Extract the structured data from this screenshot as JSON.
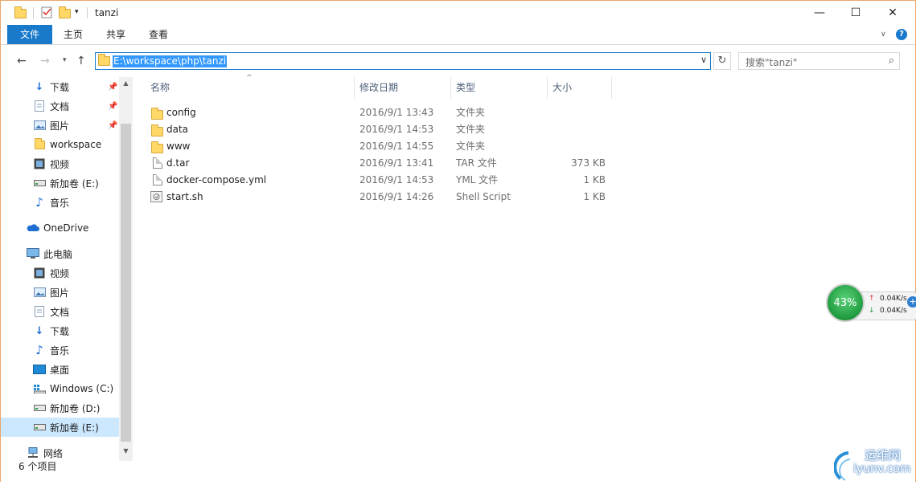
{
  "window": {
    "title": "tanzi",
    "controls": {
      "minimize": "—",
      "maximize": "☐",
      "close": "✕"
    }
  },
  "ribbon": {
    "tabs": [
      "文件",
      "主页",
      "共享",
      "查看"
    ],
    "help_icon": "?"
  },
  "address": {
    "path": "E:\\workspace\\php\\tanzi"
  },
  "search": {
    "placeholder": "搜索\"tanzi\""
  },
  "sidebar": {
    "items": [
      {
        "label": "下载",
        "icon": "download-icon",
        "pinned": true
      },
      {
        "label": "文档",
        "icon": "document-icon",
        "pinned": true
      },
      {
        "label": "图片",
        "icon": "picture-icon",
        "pinned": true
      },
      {
        "label": "workspace",
        "icon": "folder-icon",
        "pinned": false
      },
      {
        "label": "视频",
        "icon": "video-icon",
        "pinned": false
      },
      {
        "label": "新加卷 (E:)",
        "icon": "drive-icon",
        "pinned": false
      },
      {
        "label": "音乐",
        "icon": "music-icon",
        "pinned": false
      },
      {
        "label": "OneDrive",
        "icon": "cloud-icon",
        "pinned": false
      },
      {
        "label": "此电脑",
        "icon": "computer-icon",
        "pinned": false
      },
      {
        "label": "视频",
        "icon": "video-icon",
        "pinned": false
      },
      {
        "label": "图片",
        "icon": "picture-icon",
        "pinned": false
      },
      {
        "label": "文档",
        "icon": "document-icon",
        "pinned": false
      },
      {
        "label": "下载",
        "icon": "download-icon",
        "pinned": false
      },
      {
        "label": "音乐",
        "icon": "music-icon",
        "pinned": false
      },
      {
        "label": "桌面",
        "icon": "desktop-icon",
        "pinned": false
      },
      {
        "label": "Windows (C:)",
        "icon": "windows-drive-icon",
        "pinned": false
      },
      {
        "label": "新加卷 (D:)",
        "icon": "drive-icon",
        "pinned": false
      },
      {
        "label": "新加卷 (E:)",
        "icon": "drive-icon",
        "pinned": false,
        "selected": true
      },
      {
        "label": "网络",
        "icon": "network-icon",
        "pinned": false
      }
    ]
  },
  "columns": {
    "name": "名称",
    "modified": "修改日期",
    "type": "类型",
    "size": "大小"
  },
  "files": [
    {
      "name": "config",
      "modified": "2016/9/1 13:43",
      "type": "文件夹",
      "size": "",
      "kind": "folder"
    },
    {
      "name": "data",
      "modified": "2016/9/1 14:53",
      "type": "文件夹",
      "size": "",
      "kind": "folder"
    },
    {
      "name": "www",
      "modified": "2016/9/1 14:55",
      "type": "文件夹",
      "size": "",
      "kind": "folder"
    },
    {
      "name": "d.tar",
      "modified": "2016/9/1 13:41",
      "type": "TAR 文件",
      "size": "373 KB",
      "kind": "file"
    },
    {
      "name": "docker-compose.yml",
      "modified": "2016/9/1 14:53",
      "type": "YML 文件",
      "size": "1 KB",
      "kind": "file"
    },
    {
      "name": "start.sh",
      "modified": "2016/9/1 14:26",
      "type": "Shell Script",
      "size": "1 KB",
      "kind": "script"
    }
  ],
  "status": {
    "count": "6 个项目"
  },
  "net_widget": {
    "percent": "43%",
    "up": "0.04K/s",
    "down": "0.04K/s"
  },
  "watermark": {
    "text": "运维网",
    "sub": "iyunv.com"
  },
  "colors": {
    "accent": "#1979ca",
    "folder": "#ffd867",
    "selection": "#cce8ff"
  }
}
